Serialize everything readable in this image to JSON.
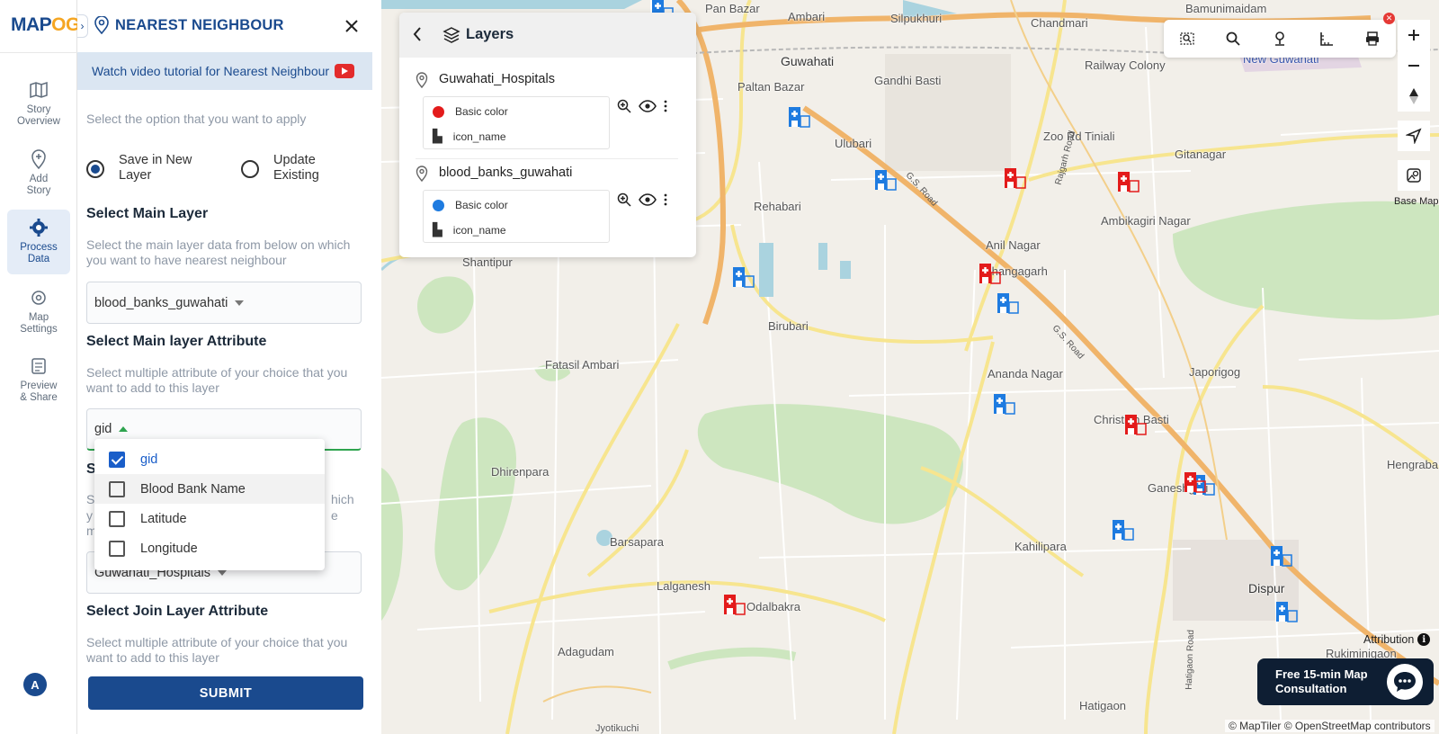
{
  "app": {
    "logo_part1": "MAP",
    "logo_part2": "OG"
  },
  "rail": {
    "items": [
      {
        "label": "Story\nOverview",
        "icon": "map-book-icon"
      },
      {
        "label": "Add\nStory",
        "icon": "map-pin-plus-icon"
      },
      {
        "label": "Process\nData",
        "icon": "gear-icon",
        "active": true
      },
      {
        "label": "Map\nSettings",
        "icon": "settings-icon"
      },
      {
        "label": "Preview\n& Share",
        "icon": "share-icon"
      }
    ],
    "avatar_initial": "A"
  },
  "panel": {
    "title": "NEAREST NEIGHBOUR",
    "video_link": "Watch video tutorial for Nearest Neighbour",
    "option_hint": "Select the option that you want to apply",
    "radio_new": "Save in New\nLayer",
    "radio_existing": "Update\nExisting",
    "main_layer_title": "Select Main Layer",
    "main_layer_hint": "Select the main layer data from below on which you want to have nearest neighbour",
    "main_layer_value": "blood_banks_guwahati",
    "main_attr_title": "Select Main layer Attribute",
    "main_attr_hint": "Select multiple attribute of your choice that you want to add to this layer",
    "main_attr_value": "gid",
    "partial_section_letter": "S",
    "partial_hint_right_1": "hich",
    "partial_hint_right_2": "e",
    "partial_hint_left_1": "S",
    "partial_hint_left_2": "y",
    "partial_hint_left_3": "m",
    "join_layer_value": "Guwahati_Hospitals",
    "join_attr_title": "Select Join Layer Attribute",
    "join_attr_hint": "Select multiple attribute of your choice that you want to add to this layer",
    "submit_label": "SUBMIT",
    "dropdown_options": [
      {
        "label": "gid",
        "checked": true
      },
      {
        "label": "Blood Bank Name",
        "checked": false
      },
      {
        "label": "Latitude",
        "checked": false
      },
      {
        "label": "Longitude",
        "checked": false
      }
    ]
  },
  "layers_panel": {
    "title": "Layers",
    "layers": [
      {
        "name": "Guwahati_Hospitals",
        "color_label": "Basic color",
        "color": "#e31b1b",
        "icon_label": "icon_name"
      },
      {
        "name": "blood_banks_guwahati",
        "color_label": "Basic color",
        "color": "#1e7be0",
        "icon_label": "icon_name"
      }
    ]
  },
  "map": {
    "places": [
      {
        "name": "Pan Bazar"
      },
      {
        "name": "Ambari"
      },
      {
        "name": "Silpukhuri"
      },
      {
        "name": "Chandmari"
      },
      {
        "name": "Bamunimaidam"
      },
      {
        "name": "Guwahati"
      },
      {
        "name": "Gandhi Basti"
      },
      {
        "name": "Railway Colony"
      },
      {
        "name": "New Guwahati"
      },
      {
        "name": "Paltan Bazar"
      },
      {
        "name": "Ulubari"
      },
      {
        "name": "Zoo Rd Tiniali"
      },
      {
        "name": "Gitanagar"
      },
      {
        "name": "Rehabari"
      },
      {
        "name": "Ambikagiri Nagar"
      },
      {
        "name": "Shantipur"
      },
      {
        "name": "Anil Nagar"
      },
      {
        "name": "Bhangagarh"
      },
      {
        "name": "Birubari"
      },
      {
        "name": "Fatasil Ambari"
      },
      {
        "name": "Ananda Nagar"
      },
      {
        "name": "Japorigog"
      },
      {
        "name": "Christian Basti"
      },
      {
        "name": "Dhirenpara"
      },
      {
        "name": "Ganeshguri"
      },
      {
        "name": "Hengrabari"
      },
      {
        "name": "Barsapara"
      },
      {
        "name": "Kahilipara"
      },
      {
        "name": "Lalganesh"
      },
      {
        "name": "Odalbakra"
      },
      {
        "name": "Dispur"
      },
      {
        "name": "Adagudam"
      },
      {
        "name": "Rukiminigaon"
      },
      {
        "name": "Hatigaon"
      },
      {
        "name": "Jyotikuchi"
      }
    ],
    "roads": [
      {
        "name": "Rajgarh Road"
      },
      {
        "name": "G.S. Road"
      },
      {
        "name": "G.S. Road"
      },
      {
        "name": "Hatigaon Road"
      }
    ],
    "basemap_label": "Base Map",
    "attribution_label": "Attribution",
    "consult_label": "Free 15-min Map\nConsultation",
    "credits": "© MapTiler © OpenStreetMap contributors",
    "hospital_color": "#e31b1b",
    "bloodbank_color": "#1e7be0"
  }
}
